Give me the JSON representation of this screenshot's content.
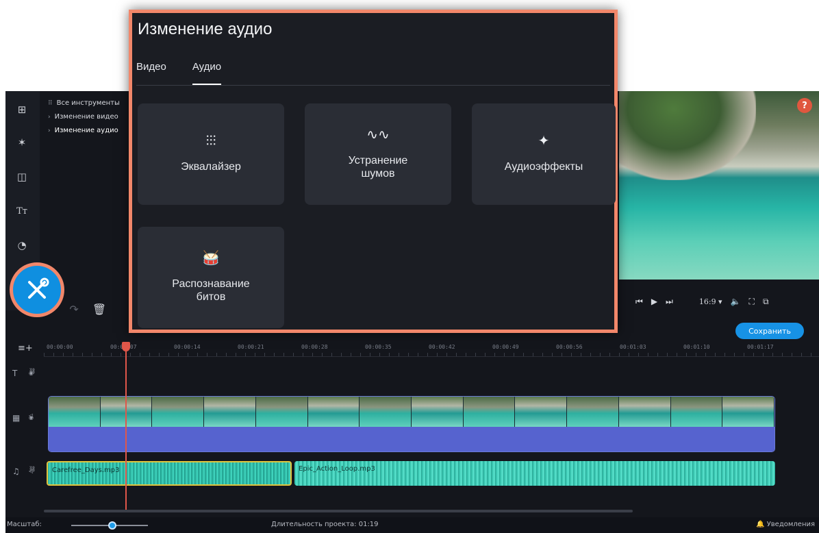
{
  "panel": {
    "title": "Изменение аудио",
    "tabs": [
      {
        "label": "Видео",
        "active": false
      },
      {
        "label": "Аудио",
        "active": true
      }
    ],
    "cards": [
      {
        "label": "Эквалайзер",
        "icon": "equalizer-icon"
      },
      {
        "label": "Устранение шумов",
        "icon": "noise-removal-icon"
      },
      {
        "label": "Аудиоэффекты",
        "icon": "magic-wand-icon"
      },
      {
        "label": "Распознавание битов",
        "icon": "drum-icon"
      }
    ]
  },
  "tree": {
    "items": [
      {
        "label": "Все инструменты",
        "mark": "⠿"
      },
      {
        "label": "Изменение видео",
        "mark": "›"
      },
      {
        "label": "Изменение аудио",
        "mark": "›"
      }
    ]
  },
  "preview": {
    "help_label": "?"
  },
  "player": {
    "ratio": "16:9 ▾"
  },
  "actions": {
    "save_label": "Сохранить"
  },
  "timeline": {
    "ticks": [
      "00:00:00",
      "00:00:07",
      "00:00:14",
      "00:00:21",
      "00:00:28",
      "00:00:35",
      "00:00:42",
      "00:00:49",
      "00:00:56",
      "00:01:03",
      "00:01:10",
      "00:01:17"
    ],
    "audio_clips": [
      {
        "label": "Carefree_Days.mp3"
      },
      {
        "label": "Epic_Action_Loop.mp3"
      }
    ]
  },
  "status": {
    "scale_label": "Масштаб:",
    "duration": "Длительность проекта: 01:19",
    "notifications": "Уведомления"
  },
  "colors": {
    "highlight": "#f2876a",
    "accent": "#1792e5",
    "video_audio": "#5663cf",
    "audio_clip": "#3fd3bd",
    "playhead": "#e0574a"
  }
}
